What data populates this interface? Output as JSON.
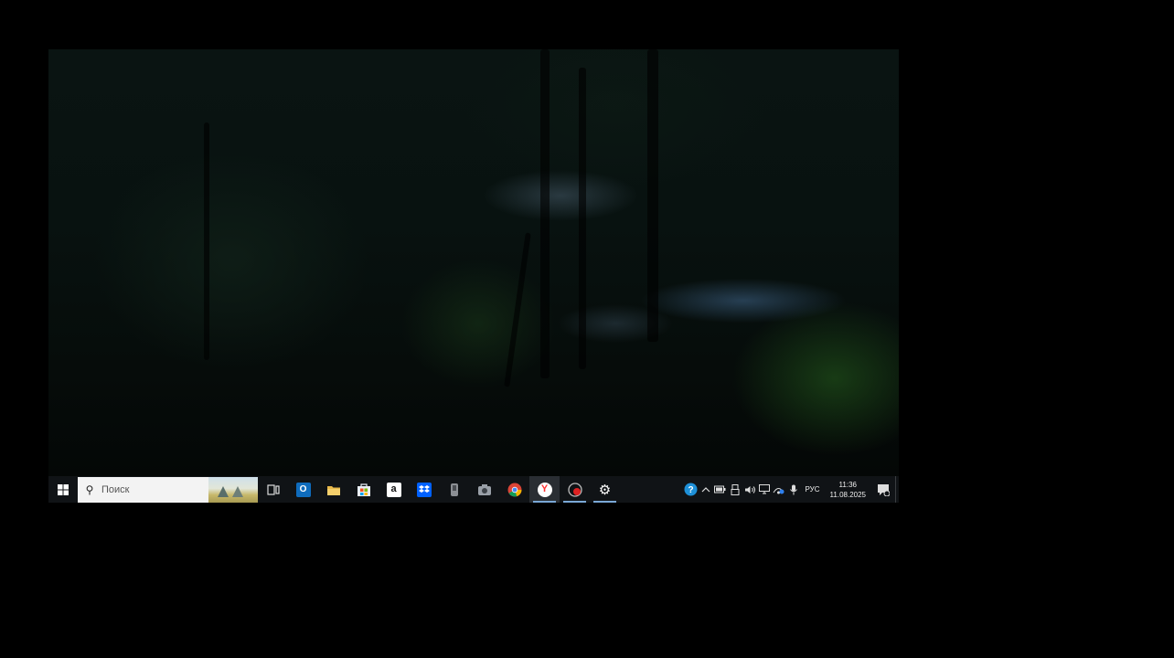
{
  "taskbar": {
    "search_placeholder": "Поиск",
    "pinned_apps": [
      {
        "name": "task-view",
        "icon": "task-view-icon"
      },
      {
        "name": "outlook",
        "icon": "outlook-icon",
        "glyph": "O",
        "color": "#0f6cbd"
      },
      {
        "name": "file-explorer",
        "icon": "folder-icon",
        "color": "#e8b84a"
      },
      {
        "name": "microsoft-store",
        "icon": "store-icon",
        "color": "#2f7fd1"
      },
      {
        "name": "amazon",
        "icon": "amazon-icon",
        "glyph": "a",
        "color": "#ffffff"
      },
      {
        "name": "dropbox",
        "icon": "dropbox-icon",
        "color": "#0061fe"
      },
      {
        "name": "media-device",
        "icon": "device-icon",
        "color": "#8c8f94"
      },
      {
        "name": "camera",
        "icon": "camera-icon",
        "color": "#9aa0a8"
      },
      {
        "name": "chrome",
        "icon": "chrome-icon"
      },
      {
        "name": "yandex-browser",
        "icon": "yandex-icon",
        "glyph": "Y",
        "color": "#f33"
      },
      {
        "name": "recorder",
        "icon": "record-icon",
        "color": "#d22"
      },
      {
        "name": "settings",
        "icon": "gear-icon",
        "glyph": "⚙"
      }
    ]
  },
  "tray": {
    "language": "РУС",
    "time": "11:36",
    "date": "11.08.2025",
    "icons": [
      "help-icon",
      "chevron-up-icon",
      "battery-icon",
      "usb-icon",
      "volume-icon",
      "display-icon",
      "network-icon",
      "microphone-icon"
    ]
  },
  "colors": {
    "taskbar_bg": "#101316",
    "accent": "#7aa8d6"
  }
}
